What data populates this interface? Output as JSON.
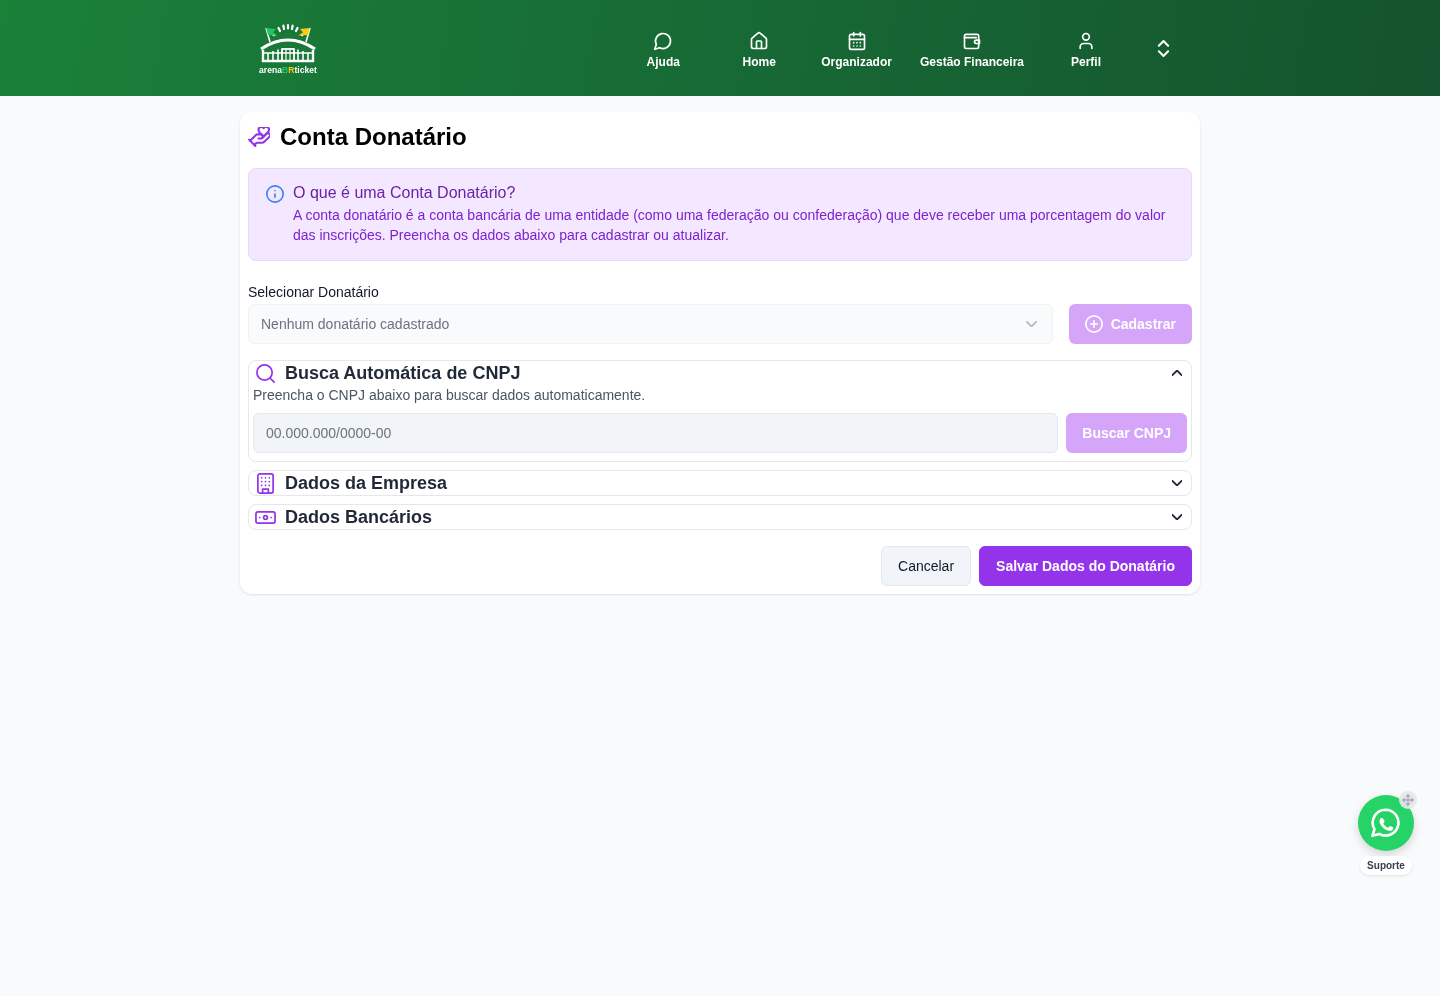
{
  "header": {
    "logo": {
      "wordmark": [
        {
          "text": "arena",
          "color": "#ffffff"
        },
        {
          "text": "B",
          "color": "#22c55e"
        },
        {
          "text": "R",
          "color": "#facc15"
        },
        {
          "text": "ticket",
          "color": "#ffffff"
        }
      ]
    },
    "nav": [
      {
        "label": "Ajuda"
      },
      {
        "label": "Home"
      },
      {
        "label": "Organizador"
      },
      {
        "label": "Gestão Financeira"
      },
      {
        "label": "Perfil"
      }
    ]
  },
  "page": {
    "title": "Conta Donatário",
    "info": {
      "title": "O que é uma Conta Donatário?",
      "text": "A conta donatário é a conta bancária de uma entidade (como uma federação ou confederação) que deve receber uma porcentagem do valor das inscrições. Preencha os dados abaixo para cadastrar ou atualizar."
    },
    "donee_select": {
      "label": "Selecionar Donatário",
      "value": "Nenhum donatário cadastrado",
      "disabled": true
    },
    "register_button": {
      "label": "Cadastrar",
      "disabled": true
    },
    "sections": [
      {
        "title": "Busca Automática de CNPJ",
        "expanded": true,
        "description": "Preencha o CNPJ abaixo para buscar dados automaticamente.",
        "cnpj_field": {
          "placeholder": "00.000.000/0000-00"
        },
        "search_button": {
          "label": "Buscar CNPJ",
          "disabled": true
        }
      },
      {
        "title": "Dados da Empresa",
        "expanded": false
      },
      {
        "title": "Dados Bancários",
        "expanded": false
      }
    ],
    "actions": [
      {
        "label": "Cancelar",
        "kind": "secondary"
      },
      {
        "label": "Salvar Dados do Donatário",
        "kind": "primary"
      }
    ]
  },
  "support_widget": {
    "label": "Suporte"
  }
}
